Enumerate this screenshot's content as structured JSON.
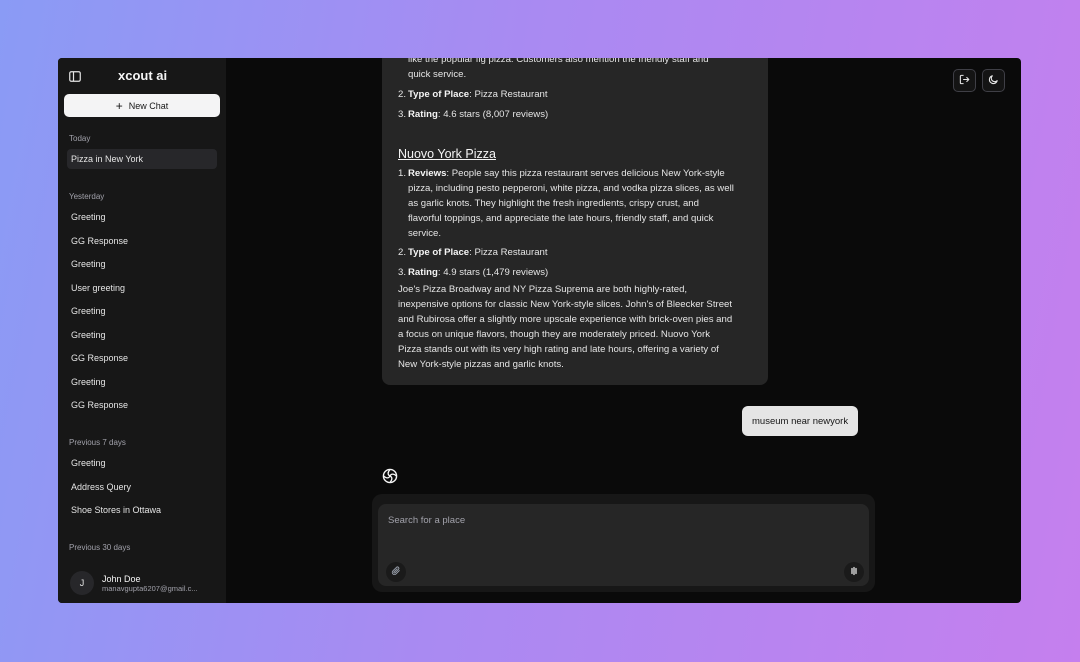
{
  "app": {
    "title": "xcout ai"
  },
  "sidebar": {
    "new_chat_label": "New Chat",
    "today_label": "Today",
    "today_items": [
      "Pizza in New York"
    ],
    "yesterday_label": "Yesterday",
    "yesterday_items": [
      "Greeting",
      "GG Response",
      "Greeting",
      "User greeting",
      "Greeting",
      "Greeting",
      "GG Response",
      "Greeting",
      "GG Response"
    ],
    "prev7_label": "Previous 7 days",
    "prev7_items": [
      "Greeting",
      "Address Query",
      "Shoe Stores in Ottawa"
    ],
    "prev30_label": "Previous 30 days",
    "user": {
      "initial": "J",
      "name": "John Doe",
      "email": "manavgupta6207@gmail.c..."
    }
  },
  "chat": {
    "prev_text_line1": "like the popular fig pizza. Customers also mention the friendly staff and",
    "prev_text_line2": "quick service.",
    "prev_type_num": "2.",
    "prev_type_label": "Type of Place",
    "prev_type_value": ": Pizza Restaurant",
    "prev_rating_num": "3.",
    "prev_rating_label": "Rating",
    "prev_rating_value": ": 4.6 stars (8,007 reviews)",
    "place_title": "Nuovo York Pizza",
    "reviews_num": "1.",
    "reviews_label": "Reviews",
    "reviews_lines": [
      ": People say this pizza restaurant serves delicious New York-style",
      "pizza, including pesto pepperoni, white pizza, and vodka pizza slices, as well",
      "as garlic knots. They highlight the fresh ingredients, crispy crust, and",
      "flavorful toppings, and appreciate the late hours, friendly staff, and quick",
      "service."
    ],
    "type_num": "2.",
    "type_label": "Type of Place",
    "type_value": ": Pizza Restaurant",
    "rating_num": "3.",
    "rating_label": "Rating",
    "rating_value": ": 4.9 stars (1,479 reviews)",
    "summary_lines": [
      "Joe's Pizza Broadway and NY Pizza Suprema are both highly-rated,",
      "inexpensive options for classic New York-style slices. John's of Bleecker Street",
      "and Rubirosa offer a slightly more upscale experience with brick-oven pies and",
      "a focus on unique flavors, though they are moderately priced. Nuovo York",
      "Pizza stands out with its very high rating and late hours, offering a variety of",
      "New York-style pizzas and garlic knots."
    ],
    "user_message": "museum near newyork"
  },
  "composer": {
    "placeholder": "Search for a place"
  },
  "icons": {
    "sidebar_toggle": "sidebar-toggle-icon",
    "logout": "logout-icon",
    "theme": "moon-icon",
    "attach": "paperclip-icon",
    "voice": "waveform-icon",
    "bot": "bot-logo-icon"
  }
}
